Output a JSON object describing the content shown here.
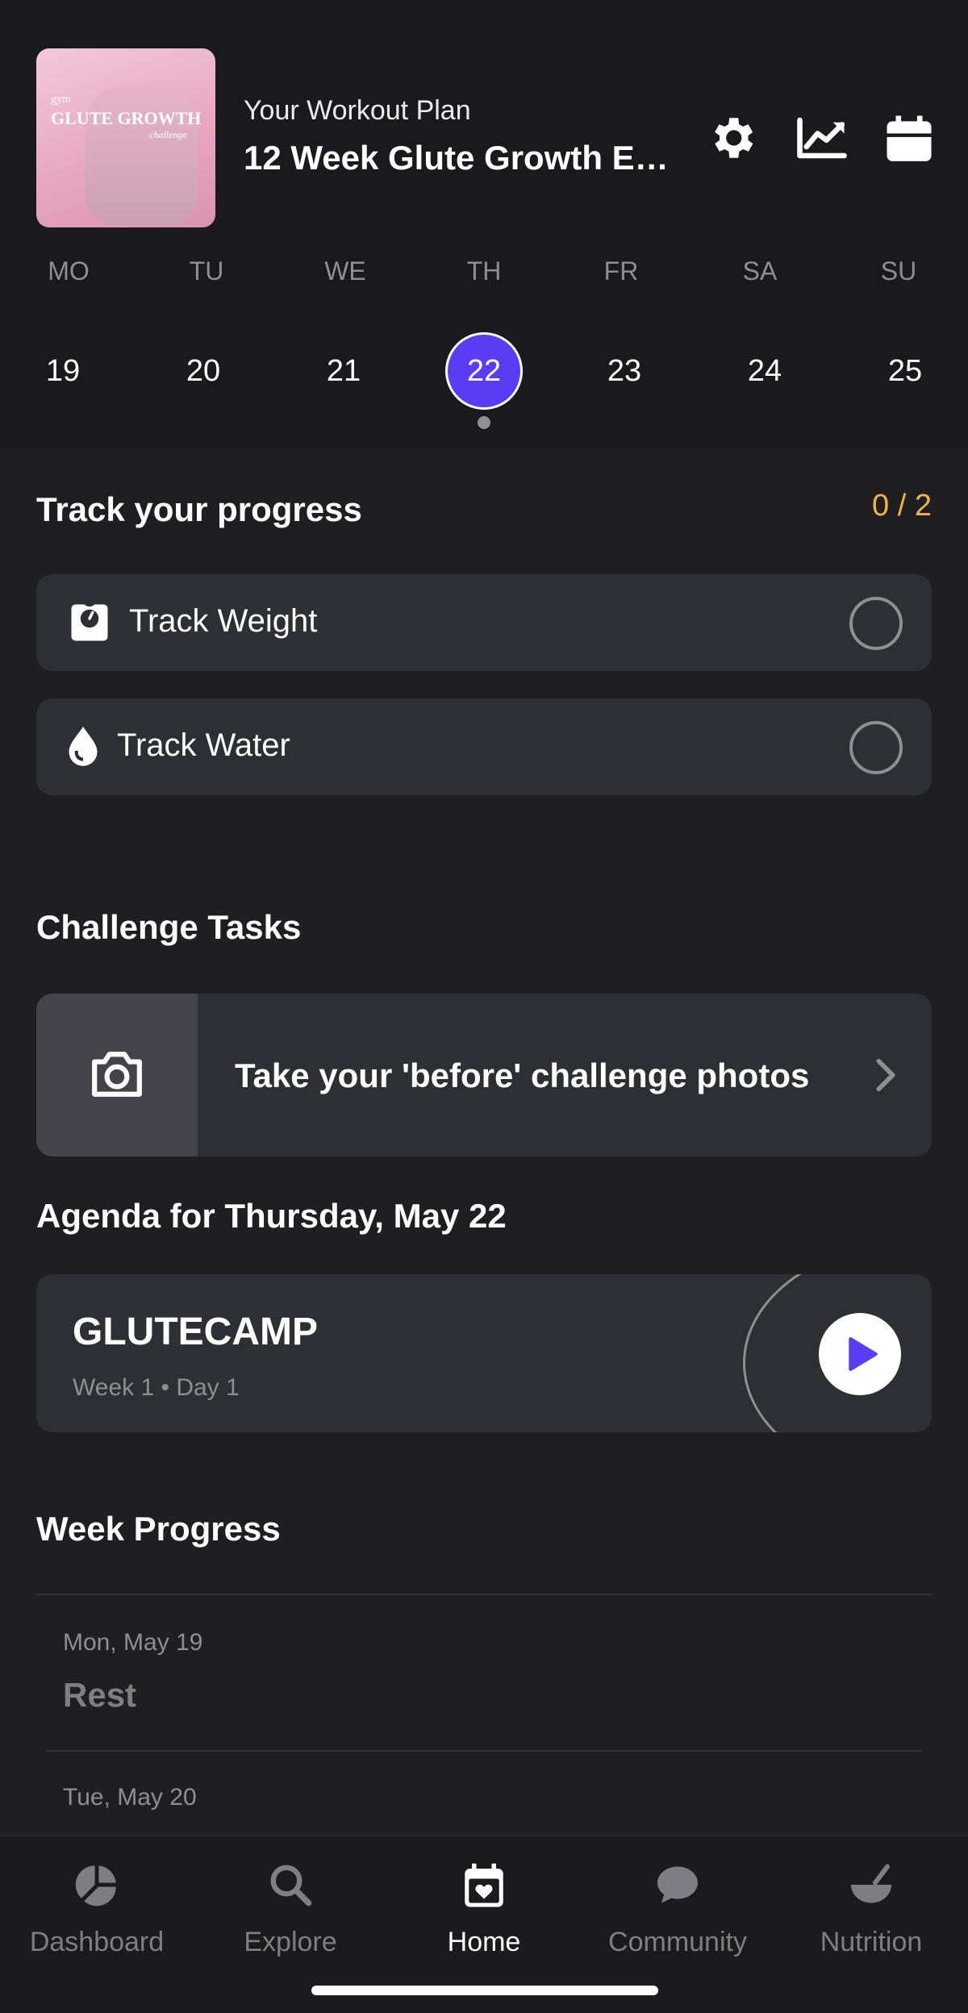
{
  "header": {
    "thumbnail_text": {
      "line1": "gym",
      "line2": "GLUTE GROWTH",
      "line3": "challenge"
    },
    "subtitle": "Your Workout Plan",
    "title": "12 Week Glute Growth Ex…",
    "icons": [
      "gear-icon",
      "chart-trend-icon",
      "calendar-icon"
    ]
  },
  "week": {
    "days": [
      "MO",
      "TU",
      "WE",
      "TH",
      "FR",
      "SA",
      "SU"
    ],
    "dates": [
      "19",
      "20",
      "21",
      "22",
      "23",
      "24",
      "25"
    ],
    "selected_index": 3,
    "accent": "#5b3cf5"
  },
  "progress": {
    "title": "Track your progress",
    "count": "0 / 2",
    "count_color": "#f0b24a",
    "items": [
      {
        "label": "Track Weight",
        "icon": "scale-icon"
      },
      {
        "label": "Track Water",
        "icon": "water-drop-icon"
      }
    ]
  },
  "challenge": {
    "title": "Challenge Tasks",
    "task_label": "Take your 'before' challenge photos",
    "icon": "camera-icon"
  },
  "agenda": {
    "title": "Agenda for Thursday, May 22",
    "workout_name": "GLUTECAMP",
    "workout_meta": "Week 1 • Day 1"
  },
  "week_progress": {
    "title": "Week Progress",
    "entries": [
      {
        "date": "Mon, May 19",
        "status": "Rest"
      },
      {
        "date": "Tue, May 20",
        "status": ""
      }
    ]
  },
  "tabbar": {
    "tabs": [
      {
        "label": "Dashboard",
        "icon": "dashboard-pie-icon"
      },
      {
        "label": "Explore",
        "icon": "search-icon"
      },
      {
        "label": "Home",
        "icon": "calendar-heart-icon",
        "active": true
      },
      {
        "label": "Community",
        "icon": "chat-bubble-icon"
      },
      {
        "label": "Nutrition",
        "icon": "bowl-icon"
      }
    ]
  }
}
